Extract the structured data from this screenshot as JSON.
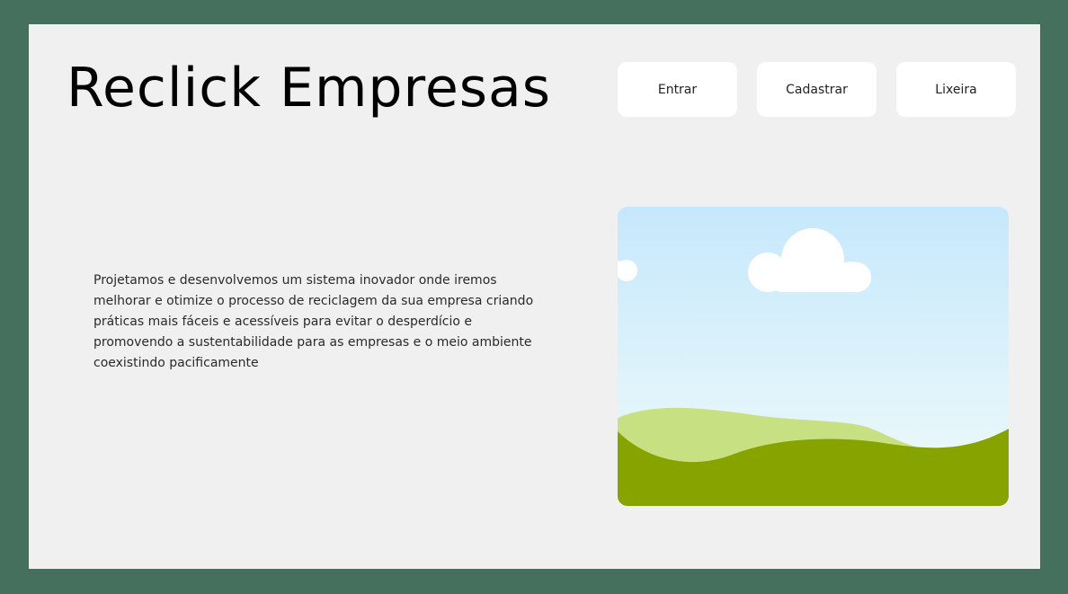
{
  "header": {
    "title": "Reclick Empresas"
  },
  "nav": {
    "entrar_label": "Entrar",
    "cadastrar_label": "Cadastrar",
    "lixeira_label": "Lixeira"
  },
  "main": {
    "description": "Projetamos e desenvolvemos um sistema inovador onde iremos melhorar e otimize o processo de reciclagem da sua empresa criando práticas mais fáceis e acessíveis para evitar o desperdício e promovendo a sustentabilidade para as empresas e o meio ambiente coexistindo pacificamente",
    "image": {
      "icon": "landscape-placeholder-image",
      "sky_top": "#c6e8fc",
      "sky_bottom": "#f0fbfa",
      "hill_light": "#c7e082",
      "hill_dark": "#86a300",
      "cloud": "#ffffff"
    }
  },
  "colors": {
    "background": "#44705d",
    "card": "#f0f0f0",
    "button": "#ffffff",
    "text": "#000000"
  }
}
